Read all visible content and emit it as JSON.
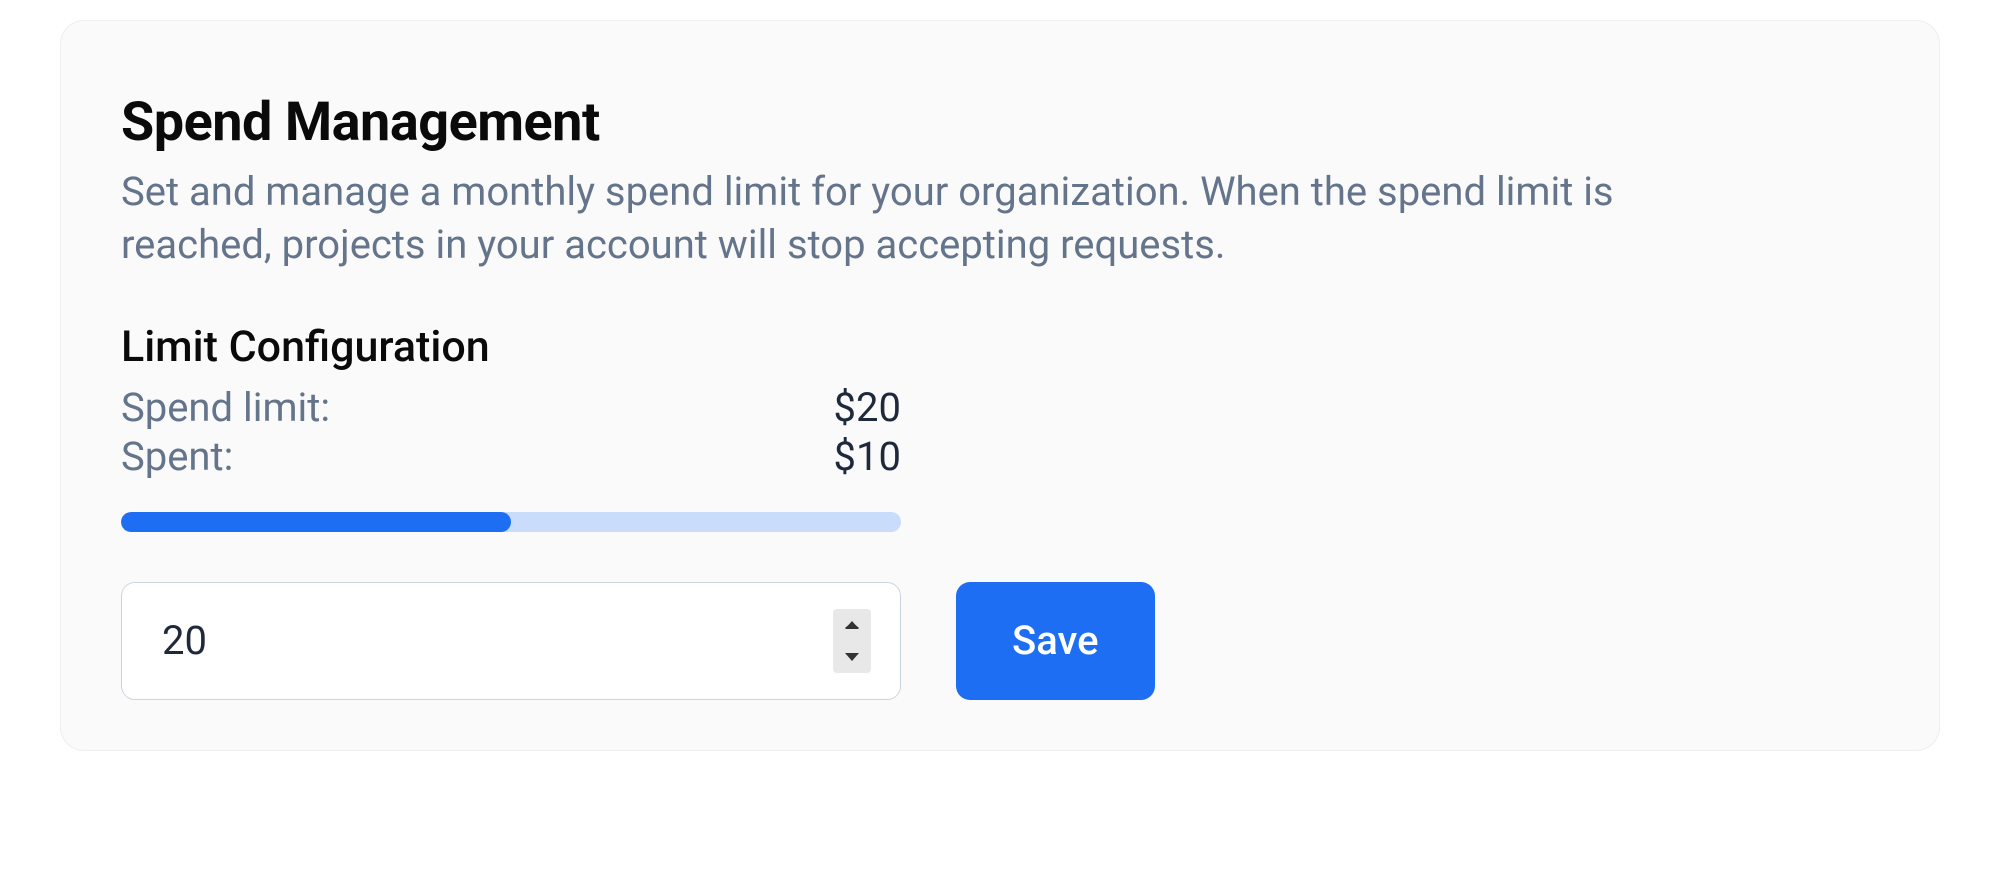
{
  "spendManagement": {
    "title": "Spend Management",
    "description": "Set and manage a monthly spend limit for your organization. When the spend limit is reached, projects in your account will stop accepting requests."
  },
  "limitConfig": {
    "title": "Limit Configuration",
    "spendLimitLabel": "Spend limit:",
    "spendLimitValue": "$20",
    "spentLabel": "Spent:",
    "spentValue": "$10",
    "progressPercent": 50,
    "inputValue": "20",
    "saveButtonLabel": "Save"
  },
  "colors": {
    "primary": "#1e6ef4",
    "progressBg": "#c9dcfc",
    "textMuted": "#64748b"
  }
}
